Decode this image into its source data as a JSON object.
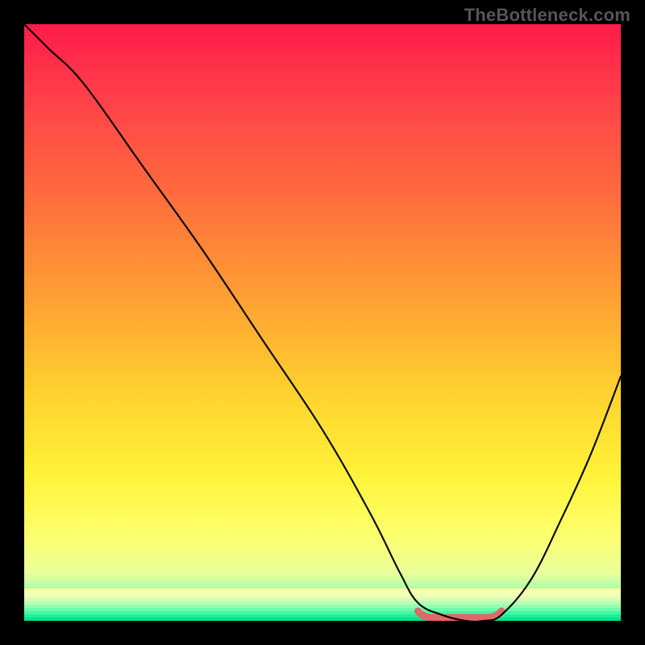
{
  "watermark": "TheBottleneck.com",
  "colors": {
    "gradient_top": "#ff1b4a",
    "gradient_bottom": "#00e58c",
    "curve": "#000000",
    "valley_highlight": "#e06868",
    "background": "#000000"
  },
  "chart_data": {
    "type": "line",
    "title": "",
    "xlabel": "",
    "ylabel": "",
    "xlim": [
      0,
      100
    ],
    "ylim": [
      0,
      100
    ],
    "grid": false,
    "legend": false,
    "series": [
      {
        "name": "bottleneck-curve",
        "x": [
          0,
          4,
          10,
          20,
          30,
          40,
          50,
          58,
          63,
          66,
          70,
          74,
          77,
          80,
          85,
          90,
          95,
          100
        ],
        "values": [
          100,
          96,
          90,
          76,
          62,
          47,
          32,
          18,
          8,
          3,
          1,
          0,
          0,
          1,
          7,
          17,
          28,
          41
        ],
        "note": "y is bottleneck percentage; 0 = optimal (bottom), 100 = worst (top)"
      }
    ],
    "highlight": {
      "name": "valley-optimal-range",
      "x_range": [
        66,
        80
      ],
      "y_approx": 0
    },
    "background_gradient": {
      "orientation": "vertical",
      "stops": [
        {
          "pos": 0.0,
          "color": "#ff1b4a"
        },
        {
          "pos": 0.28,
          "color": "#ff6a3e"
        },
        {
          "pos": 0.62,
          "color": "#ffd22e"
        },
        {
          "pos": 0.86,
          "color": "#fdff6f"
        },
        {
          "pos": 1.0,
          "color": "#00e58c"
        }
      ]
    }
  }
}
